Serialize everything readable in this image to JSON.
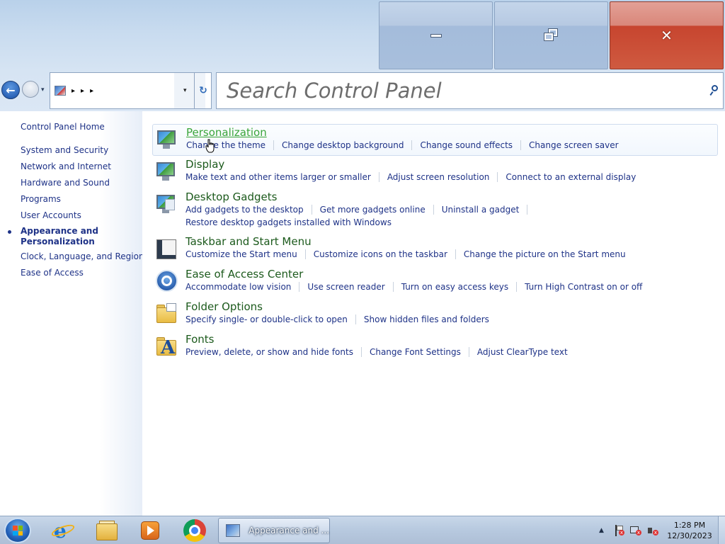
{
  "window": {
    "minimize_icon": "minimize-icon",
    "maximize_icon": "restore-icon",
    "close_icon": "close-icon",
    "close_glyph": "✕"
  },
  "nav": {
    "back_icon": "back-arrow-icon",
    "forward_icon": "forward-arrow-icon",
    "back_glyph": "←",
    "recent_glyph": "▾",
    "address_dropdown_glyph": "▾",
    "refresh_glyph": "↻",
    "search_placeholder": "Search Control Panel"
  },
  "left_pane": {
    "home": "Control Panel Home",
    "items": [
      "System and Security",
      "Network and Internet",
      "Hardware and Sound",
      "Programs",
      "User Accounts"
    ],
    "active_line1": "Appearance and",
    "active_line2": "Personalization",
    "items_after": [
      "Clock, Language, and Region",
      "Ease of Access"
    ]
  },
  "categories": [
    {
      "title": "Personalization",
      "icon": "personalization-icon",
      "links": [
        "Change the theme",
        "Change desktop background",
        "Change sound effects",
        "Change screen saver"
      ]
    },
    {
      "title": "Display",
      "icon": "display-icon",
      "links": [
        "Make text and other items larger or smaller",
        "Adjust screen resolution",
        "Connect to an external display"
      ]
    },
    {
      "title": "Desktop Gadgets",
      "icon": "desktop-gadgets-icon",
      "links": [
        "Add gadgets to the desktop",
        "Get more gadgets online",
        "Uninstall a gadget"
      ],
      "links2": [
        "Restore desktop gadgets installed with Windows"
      ]
    },
    {
      "title": "Taskbar and Start Menu",
      "icon": "taskbar-icon",
      "links": [
        "Customize the Start menu",
        "Customize icons on the taskbar",
        "Change the picture on the Start menu"
      ]
    },
    {
      "title": "Ease of Access Center",
      "icon": "ease-of-access-icon",
      "links": [
        "Accommodate low vision",
        "Use screen reader",
        "Turn on easy access keys",
        "Turn High Contrast on or off"
      ]
    },
    {
      "title": "Folder Options",
      "icon": "folder-options-icon",
      "links": [
        "Specify single- or double-click to open",
        "Show hidden files and folders"
      ]
    },
    {
      "title": "Fonts",
      "icon": "fonts-icon",
      "links": [
        "Preview, delete, or show and hide fonts",
        "Change Font Settings",
        "Adjust ClearType text"
      ]
    }
  ],
  "taskbar": {
    "start_icon": "windows-start-icon",
    "pinned": [
      "internet-explorer-icon",
      "file-explorer-icon",
      "media-player-icon",
      "chrome-icon"
    ],
    "active_window_label": "Appearance and ...",
    "tray_arrow": "▲",
    "tray_x": "x",
    "clock_time": "1:28 PM",
    "clock_date": "12/30/2023"
  },
  "colors": {
    "link": "#1e3287",
    "category_title": "#1c5a1c",
    "category_title_hover": "#3aa53a",
    "close_button": "#c7452f"
  }
}
